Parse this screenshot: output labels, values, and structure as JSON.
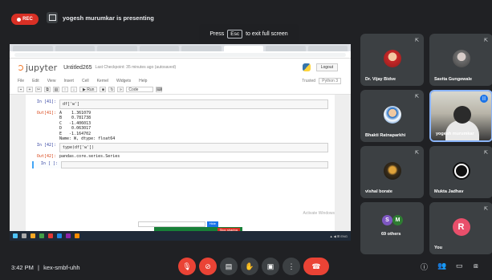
{
  "meet": {
    "rec_label": "REC",
    "presenting_text": "yogesh murumkar is presenting",
    "fullscreen_hint_pre": "Press",
    "fullscreen_hint_key": "Esc",
    "fullscreen_hint_post": "to exit full screen",
    "time": "3:42 PM",
    "separator": "|",
    "meeting_code": "kex-smbf-uhh"
  },
  "jupyter": {
    "logo_text": "jupyter",
    "notebook_title": "Untitled265",
    "checkpoint": "Last Checkpoint: 35 minutes ago (autosaved)",
    "logout_label": "Logout",
    "menu": [
      "File",
      "Edit",
      "View",
      "Insert",
      "Cell",
      "Kernel",
      "Widgets",
      "Help"
    ],
    "trusted": "Trusted",
    "kernel": "Python 3",
    "run_label": "Run",
    "cell_type": "Code",
    "cells": [
      {
        "prompt": "In [41]:",
        "code": "df['w']",
        "kind": "in"
      },
      {
        "prompt": "Out[41]:",
        "output": "A    1.361079\nB    0.781738\nC   -1.406013\nD    0.063017\nE   -1.164702\nName: W, dtype: float64",
        "kind": "out"
      },
      {
        "prompt": "In [42]:",
        "code": "type(df['w'])",
        "kind": "in"
      },
      {
        "prompt": "Out[42]:",
        "output": "pandas.core.series.Series",
        "kind": "out"
      },
      {
        "prompt": "In [ ]:",
        "code": "",
        "kind": "in"
      }
    ],
    "share_bar_button": "Hide",
    "stop_share": "Stop sharing",
    "watermark": "Activate Windows"
  },
  "participants": [
    {
      "name": "Dr. Vijay Bidve",
      "avatar": "photo-red"
    },
    {
      "name": "Savita Gungewale",
      "avatar": "photo-gray"
    },
    {
      "name": "Bhakti Ratnaparkhi",
      "avatar": "photo-blue"
    },
    {
      "name": "yogesh murumkar",
      "avatar": "video"
    },
    {
      "name": "vishal borate",
      "avatar": "photo-dark"
    },
    {
      "name": "Mukta Jadhav",
      "avatar": "obs-logo"
    },
    {
      "name": "69 others",
      "initials": [
        "S",
        "M"
      ]
    },
    {
      "name": "You",
      "initial": "R"
    }
  ],
  "colors": {
    "meet_bg": "#202124",
    "tile_bg": "#3c4043",
    "danger": "#ea4335",
    "accent": "#8ab4f8"
  }
}
